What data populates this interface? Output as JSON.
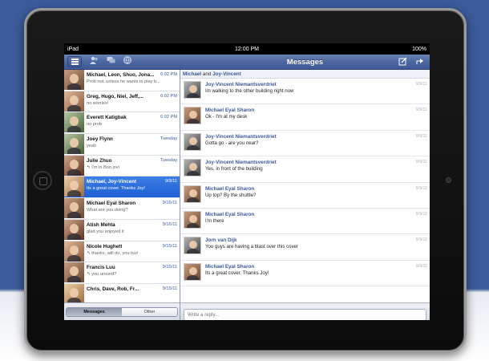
{
  "status_bar": {
    "device": "iPad",
    "time": "12:00 PM",
    "battery": "100%"
  },
  "nav": {
    "title": "Messages"
  },
  "icons": {
    "friends": "friends-icon",
    "messages": "messages-icon",
    "globe": "globe-icon",
    "compose": "compose-icon",
    "share": "share-icon"
  },
  "threads": [
    {
      "name": "Michael, Leon, Shuo, Jona...",
      "date": "6:02 PM",
      "preview": "Prob not, unless he wants to play b..."
    },
    {
      "name": "Greg, Hugo, Niel, Jeff,...",
      "date": "6:02 PM",
      "preview": "no worries!"
    },
    {
      "name": "Everett Katigbak",
      "date": "6:02 PM",
      "preview": "no prob"
    },
    {
      "name": "Joey Flynn",
      "date": "Tuesday",
      "preview": "yeah"
    },
    {
      "name": "Julie Zhuo",
      "date": "Tuesday",
      "preview": "↰ I'm in Bon jovi"
    },
    {
      "name": "Michael, Joy-Vincent",
      "date": "9/9/11",
      "preview": "Its a great cover. Thanks Joy!"
    },
    {
      "name": "Michael Eyal Sharon",
      "date": "9/16/11",
      "preview": "What are you doing?"
    },
    {
      "name": "Atish Mehta",
      "date": "9/16/11",
      "preview": "glad you enjoyed it"
    },
    {
      "name": "Nicole Hughett",
      "date": "9/15/11",
      "preview": "↰ thanks, will do, you too!"
    },
    {
      "name": "Francis Luu",
      "date": "9/15/11",
      "preview": "↰ you around?"
    },
    {
      "name": "Chris, Dave, Rob, Fr...",
      "date": "9/15/11",
      "preview": ""
    }
  ],
  "segments": {
    "messages": "Messages",
    "other": "Other"
  },
  "conversation": {
    "header_name1": "Michael",
    "header_and": "and",
    "header_name2": "Joy-Vincent"
  },
  "messages": [
    {
      "name": "Joy-Vincent Niemantsverdriet",
      "date": "9/9/11",
      "text": "Im walking to the other building right now"
    },
    {
      "name": "Michael Eyal Sharon",
      "date": "9/9/11",
      "text": "Ok - I'm at my desk"
    },
    {
      "name": "Joy-Vincent Niemantsverdriet",
      "date": "9/9/11",
      "text": "Gotta go - are you near?"
    },
    {
      "name": "Joy-Vincent Niemantsverdriet",
      "date": "9/9/11",
      "text": "Yes, in front of the building"
    },
    {
      "name": "Michael Eyal Sharon",
      "date": "9/9/11",
      "text": "Up top? By the shuttle?"
    },
    {
      "name": "Michael Eyal Sharon",
      "date": "9/9/11",
      "text": "I'm there"
    },
    {
      "name": "Jorn van Dijk",
      "date": "9/9/11",
      "text": "You guys are having a blast over this cover"
    },
    {
      "name": "Michael Eyal Sharon",
      "date": "9/9/11",
      "text": "Its a great cover. Thanks Joy!"
    }
  ],
  "reply": {
    "placeholder": "Write a reply..."
  }
}
